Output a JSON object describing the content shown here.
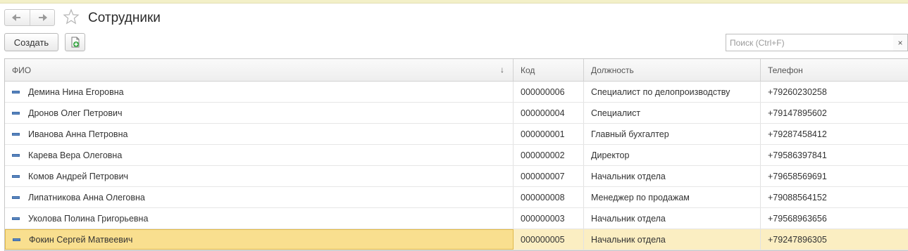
{
  "window": {
    "title": "Сотрудники"
  },
  "toolbar": {
    "create_label": "Создать"
  },
  "search": {
    "placeholder": "Поиск (Ctrl+F)",
    "value": "",
    "clear_label": "×"
  },
  "table": {
    "columns": [
      "ФИО",
      "Код",
      "Должность",
      "Телефон"
    ],
    "sort_indicator": "↓",
    "rows": [
      {
        "name": "Демина Нина Егоровна",
        "code": "000000006",
        "position": "Специалист по делопроизводству",
        "phone": "+79260230258"
      },
      {
        "name": "Дронов Олег Петрович",
        "code": "000000004",
        "position": "Специалист",
        "phone": "+79147895602"
      },
      {
        "name": "Иванова Анна Петровна",
        "code": "000000001",
        "position": "Главный бухгалтер",
        "phone": "+79287458412"
      },
      {
        "name": "Карева Вера Олеговна",
        "code": "000000002",
        "position": "Директор",
        "phone": "+79586397841"
      },
      {
        "name": "Комов Андрей Петрович",
        "code": "000000007",
        "position": "Начальник отдела",
        "phone": "+79658569691"
      },
      {
        "name": "Липатникова Анна Олеговна",
        "code": "000000008",
        "position": "Менеджер по продажам",
        "phone": "+79088564152"
      },
      {
        "name": "Уколова Полина Григорьевна",
        "code": "000000003",
        "position": "Начальник отдела",
        "phone": "+79568963656"
      },
      {
        "name": "Фокин Сергей Матвеевич",
        "code": "000000005",
        "position": "Начальник отдела",
        "phone": "+79247896305"
      }
    ],
    "selected_row": 7
  },
  "icons": {
    "back": "arrow-left-icon",
    "forward": "arrow-right-icon",
    "favorite": "star-icon",
    "add_copy": "document-add-icon",
    "row": "catalog-item-icon"
  },
  "colors": {
    "selected_row": "#fbeec2",
    "selected_cell": "#f9df8f",
    "row_icon": "#5a86c0"
  }
}
